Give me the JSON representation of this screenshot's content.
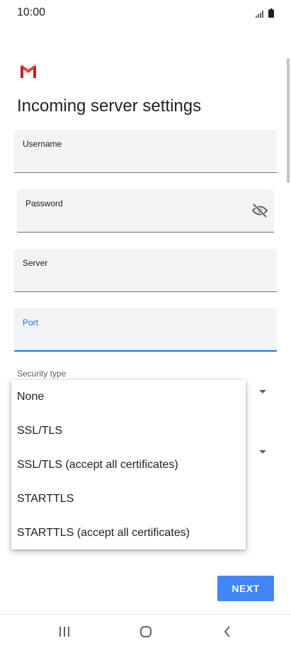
{
  "status_bar": {
    "time": "10:00"
  },
  "header": {
    "logo_icon": "gmail-logo",
    "title": "Incoming server settings"
  },
  "form": {
    "username": {
      "label": "Username",
      "value": ""
    },
    "password": {
      "label": "Password",
      "value": "",
      "toggle_icon": "visibility-off-icon"
    },
    "server": {
      "label": "Server",
      "value": ""
    },
    "port": {
      "label": "Port",
      "value": "",
      "focused": true
    },
    "security_type": {
      "label": "Security type"
    }
  },
  "security_dropdown": {
    "options": [
      "None",
      "SSL/TLS",
      "SSL/TLS (accept all certificates)",
      "STARTTLS",
      "STARTTLS (accept all certificates)"
    ]
  },
  "actions": {
    "next_label": "NEXT"
  },
  "colors": {
    "accent": "#1a73e8",
    "button": "#4285f4",
    "field_bg": "#f1f3f4",
    "gmail_red": "#ea4335"
  },
  "nav_bar": {
    "icons": [
      "recent-apps-icon",
      "home-icon",
      "back-icon"
    ]
  }
}
